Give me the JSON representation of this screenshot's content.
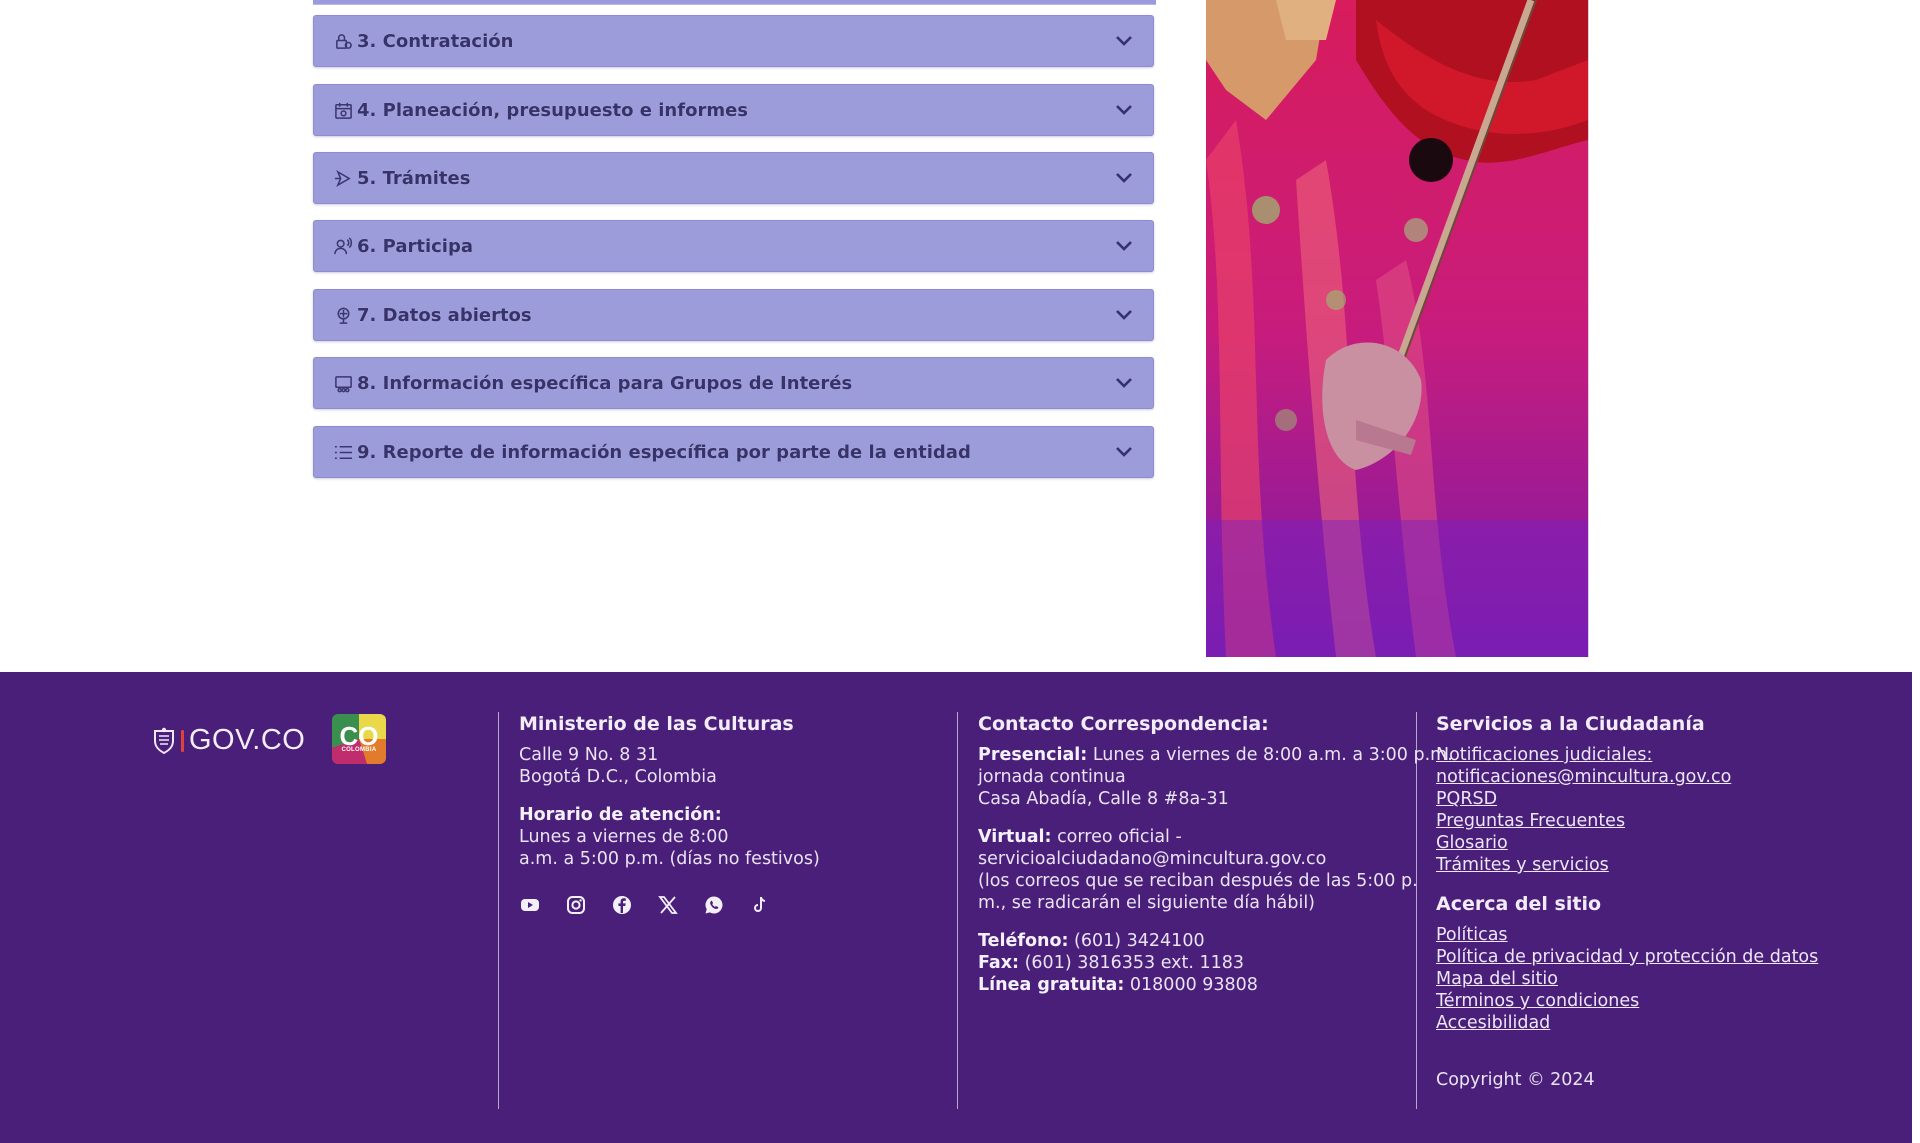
{
  "accordion": {
    "items": [
      {
        "label": "3. Contratación",
        "icon": "contract-lock-icon"
      },
      {
        "label": "4. Planeación, presupuesto e informes",
        "icon": "calendar-icon"
      },
      {
        "label": "5. Trámites",
        "icon": "procedure-arrow-icon"
      },
      {
        "label": "6. Participa",
        "icon": "participate-people-icon"
      },
      {
        "label": "7. Datos abiertos",
        "icon": "open-data-icon"
      },
      {
        "label": "8. Información específica para Grupos de Interés",
        "icon": "interest-groups-icon"
      },
      {
        "label": "9. Reporte de información específica por parte de la entidad",
        "icon": "list-icon"
      }
    ]
  },
  "side_image": {
    "subject": "violinist photo"
  },
  "footer": {
    "gov_logo_text": "GOV.CO",
    "co_logo_text": "CO",
    "co_logo_sub": "COLOMBIA",
    "ministry": {
      "title": "Ministerio de las Culturas",
      "address_1": "Calle 9 No. 8 31",
      "address_2": "Bogotá D.C., Colombia",
      "hours_title": "Horario de atención:",
      "hours_1": "Lunes a viernes de 8:00",
      "hours_2": "a.m. a 5:00 p.m. (días no festivos)"
    },
    "social": [
      "youtube-icon",
      "instagram-icon",
      "facebook-icon",
      "x-icon",
      "whatsapp-icon",
      "tiktok-icon"
    ],
    "contact": {
      "title": "Contacto Correspondencia:",
      "presencial_label": "Presencial:",
      "presencial_1": " Lunes a viernes de 8:00 a.m. a 3:00 p.m.",
      "presencial_2": "jornada continua",
      "presencial_3": "Casa Abadía, Calle 8 #8a-31",
      "virtual_label": "Virtual:",
      "virtual_1": " correo oficial -",
      "virtual_2": "servicioalciudadano@mincultura.gov.co",
      "virtual_3": "(los correos que se reciban después de las 5:00 p.",
      "virtual_4": "m., se radicarán el siguiente día hábil)",
      "phone_label": "Teléfono:",
      "phone": " (601) 3424100",
      "fax_label": "Fax:",
      "fax": " (601) 3816353 ext. 1183",
      "free_label": "Línea gratuita:",
      "free": " 018000 93808"
    },
    "services": {
      "title": "Servicios a la Ciudadanía",
      "links": [
        "Notificaciones judiciales:",
        "notificaciones@mincultura.gov.co",
        "PQRSD",
        "Preguntas Frecuentes",
        "Glosario",
        "Trámites y servicios"
      ],
      "about_title": "Acerca del sitio",
      "about_links": [
        "Políticas",
        "Política de privacidad y protección de datos",
        "Mapa del sitio",
        "Términos y condiciones",
        "Accesibilidad"
      ],
      "copyright": "Copyright © 2024"
    }
  },
  "colors": {
    "accordion_bg": "#9c9cda",
    "footer_bg": "#4a1f7a",
    "text_dark": "#37336a"
  }
}
